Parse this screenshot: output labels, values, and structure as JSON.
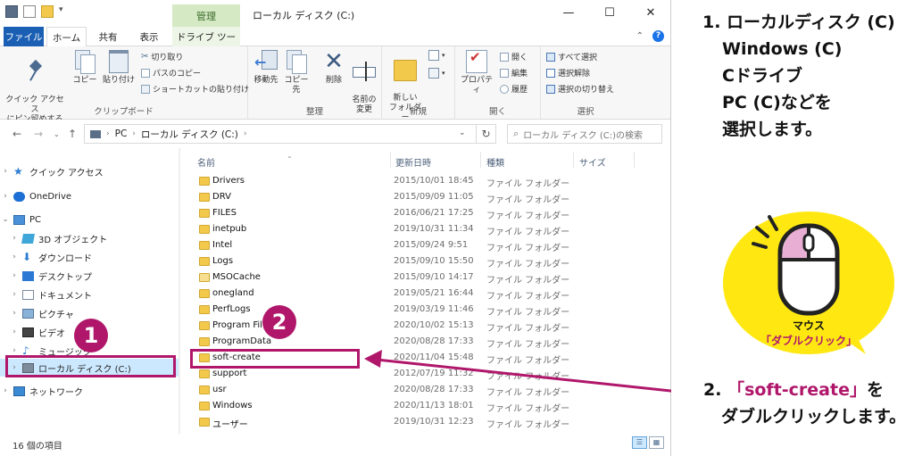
{
  "window": {
    "title": "ローカル ディスク (C:)",
    "context_tab_header": "管理",
    "controls": [
      "—",
      "☐",
      "✕"
    ]
  },
  "tabs": [
    "ファイル",
    "ホーム",
    "共有",
    "表示",
    "ドライブ ツール"
  ],
  "ribbon": {
    "clipboard": {
      "pin": "クイック アクセス\nにピン留めする",
      "copy": "コピー",
      "paste": "貼り付け",
      "cut": "切り取り",
      "copy_path": "パスのコピー",
      "paste_shortcut": "ショートカットの貼り付け",
      "label": "クリップボード"
    },
    "organize": {
      "move_to": "移動先",
      "copy_to": "コピー先",
      "delete": "削除",
      "rename": "名前の\n変更",
      "label": "整理"
    },
    "new": {
      "new_folder": "新しい\nフォルダー",
      "label": "新規"
    },
    "open": {
      "properties": "プロパティ",
      "open": "開く",
      "edit": "編集",
      "history": "履歴",
      "label": "開く"
    },
    "select": {
      "select_all": "すべて選択",
      "select_none": "選択解除",
      "invert": "選択の切り替え",
      "label": "選択"
    }
  },
  "address": {
    "path": [
      "PC",
      "ローカル ディスク (C:)"
    ],
    "search_placeholder": "ローカル ディスク (C:)の検索"
  },
  "nav_pane": [
    {
      "label": "クイック アクセス",
      "icon": "star-icon",
      "indent": 0
    },
    {
      "label": "OneDrive",
      "icon": "cloud-icon",
      "indent": 0
    },
    {
      "label": "PC",
      "icon": "pc-icon",
      "indent": 0,
      "expanded": true
    },
    {
      "label": "3D オブジェクト",
      "icon": "3d-objects-icon",
      "indent": 1
    },
    {
      "label": "ダウンロード",
      "icon": "download-icon",
      "indent": 1
    },
    {
      "label": "デスクトップ",
      "icon": "desktop-icon",
      "indent": 1
    },
    {
      "label": "ドキュメント",
      "icon": "documents-icon",
      "indent": 1
    },
    {
      "label": "ピクチャ",
      "icon": "pictures-icon",
      "indent": 1
    },
    {
      "label": "ビデオ",
      "icon": "videos-icon",
      "indent": 1
    },
    {
      "label": "ミュージック",
      "icon": "music-icon",
      "indent": 1
    },
    {
      "label": "ローカル ディスク (C:)",
      "icon": "drive-icon",
      "indent": 1,
      "selected": true
    },
    {
      "label": "ネットワーク",
      "icon": "network-icon",
      "indent": 0
    }
  ],
  "columns": [
    "名前",
    "更新日時",
    "種類",
    "サイズ"
  ],
  "files": [
    {
      "name": "Drivers",
      "date": "2015/10/01 18:45",
      "type": "ファイル フォルダー"
    },
    {
      "name": "DRV",
      "date": "2015/09/09 11:05",
      "type": "ファイル フォルダー"
    },
    {
      "name": "FILES",
      "date": "2016/06/21 17:25",
      "type": "ファイル フォルダー"
    },
    {
      "name": "inetpub",
      "date": "2019/10/31 11:34",
      "type": "ファイル フォルダー"
    },
    {
      "name": "Intel",
      "date": "2015/09/24 9:51",
      "type": "ファイル フォルダー"
    },
    {
      "name": "Logs",
      "date": "2015/09/10 15:50",
      "type": "ファイル フォルダー"
    },
    {
      "name": "MSOCache",
      "date": "2015/09/10 14:17",
      "type": "ファイル フォルダー"
    },
    {
      "name": "onegland",
      "date": "2019/05/21 16:44",
      "type": "ファイル フォルダー"
    },
    {
      "name": "PerfLogs",
      "date": "2019/03/19 11:46",
      "type": "ファイル フォルダー"
    },
    {
      "name": "Program Files",
      "date": "2020/10/02 15:13",
      "type": "ファイル フォルダー"
    },
    {
      "name": "ProgramData",
      "date": "2020/08/28 17:33",
      "type": "ファイル フォルダー"
    },
    {
      "name": "soft-create",
      "date": "2020/11/04 15:48",
      "type": "ファイル フォルダー"
    },
    {
      "name": "support",
      "date": "2012/07/19 11:32",
      "type": "ファイル フォルダー"
    },
    {
      "name": "usr",
      "date": "2020/08/28 17:33",
      "type": "ファイル フォルダー"
    },
    {
      "name": "Windows",
      "date": "2020/11/13 18:01",
      "type": "ファイル フォルダー"
    },
    {
      "name": "ユーザー",
      "date": "2019/10/31 12:23",
      "type": "ファイル フォルダー"
    }
  ],
  "status": "16 個の項目",
  "annotations": {
    "badge1": "1",
    "badge2": "2",
    "step1_lines": [
      "1. ローカルディスク (C)",
      "Windows (C)",
      "Cドライブ",
      "PC (C)などを",
      "選択します。"
    ],
    "step2_prefix": "2. ",
    "step2_target": "「soft-create」",
    "step2_suffix": "を",
    "step2_line2": "ダブルクリックします。",
    "mouse_label": "マウス",
    "mouse_action": "「ダブルクリック」",
    "accent_color": "#b0176b",
    "badge_color": "#ffe812"
  }
}
